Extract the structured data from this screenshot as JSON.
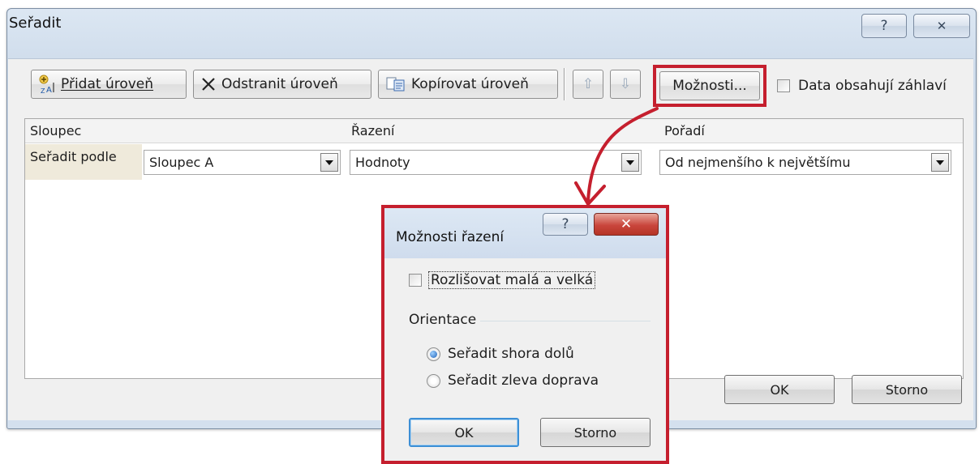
{
  "main_dialog": {
    "title": "Seřadit",
    "help_glyph": "?",
    "close_glyph": "✕",
    "toolbar": {
      "add_level": "Přidat úroveň",
      "delete_level": "Odstranit úroveň",
      "copy_level": "Kopírovat úroveň",
      "move_up": "⇧",
      "move_down": "⇩",
      "options": "Možnosti...",
      "has_headers_label": "Data obsahují záhlaví",
      "has_headers_checked": false
    },
    "grid": {
      "headers": {
        "column": "Sloupec",
        "sort_on": "Řazení",
        "order": "Pořadí"
      },
      "row": {
        "label": "Seřadit podle",
        "column_value": "Sloupec A",
        "sort_on_value": "Hodnoty",
        "order_value": "Od nejmenšího k největšímu"
      }
    },
    "ok": "OK",
    "cancel": "Storno"
  },
  "options_dialog": {
    "title": "Možnosti řazení",
    "help_glyph": "?",
    "close_glyph": "✕",
    "case_sensitive_label": "Rozlišovat malá a velká",
    "case_sensitive_checked": false,
    "orientation_label": "Orientace",
    "orientation_options": [
      {
        "label": "Seřadit shora dolů",
        "selected": true
      },
      {
        "label": "Seřadit zleva doprava",
        "selected": false
      }
    ],
    "ok": "OK",
    "cancel": "Storno"
  },
  "colors": {
    "highlight_red": "#c51f2e",
    "caption_blue": "#d4e0ee",
    "close_red": "#c9463c"
  },
  "icons": {
    "add_level": "add-sort-level-icon",
    "delete_level": "delete-x-icon",
    "copy_level": "copy-icon",
    "help": "help-icon",
    "close": "close-icon"
  }
}
